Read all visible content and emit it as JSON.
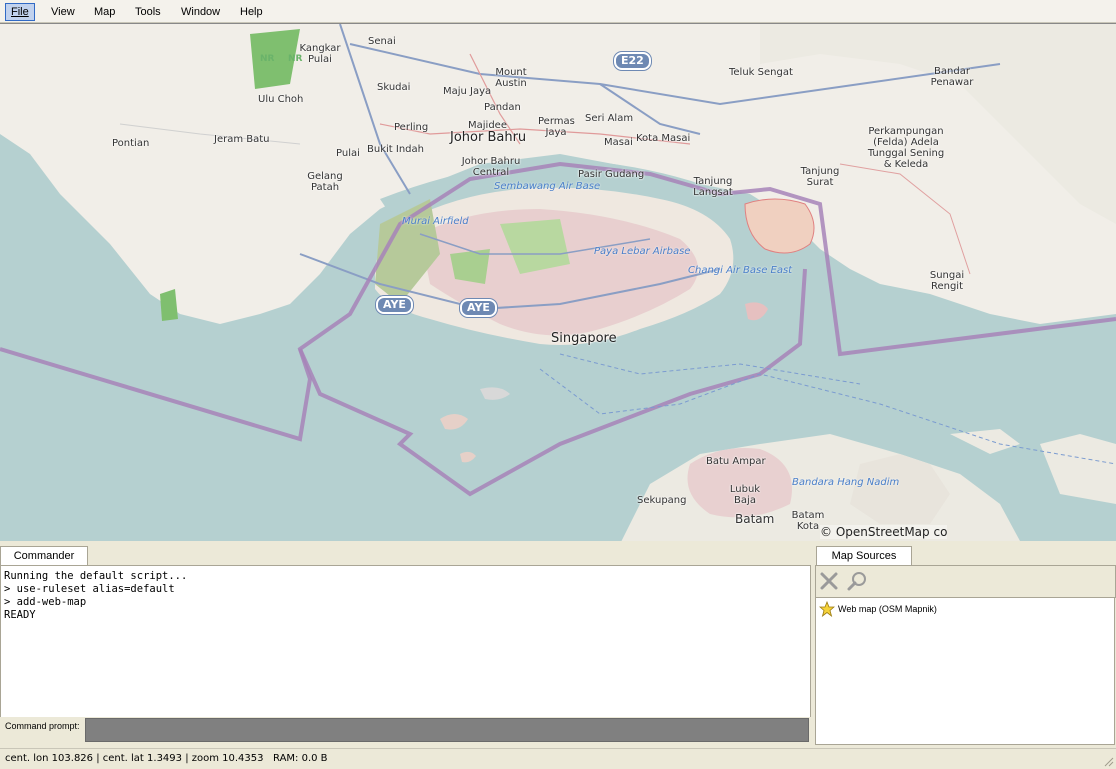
{
  "menu": {
    "file": "File",
    "view": "View",
    "map": "Map",
    "tools": "Tools",
    "window": "Window",
    "help": "Help"
  },
  "map": {
    "labels": {
      "senai": "Senai",
      "kangkar_pulai": "Kangkar Pulai",
      "ulu_choh": "Ulu Choh",
      "skudai": "Skudai",
      "majujaya": "Maju Jaya",
      "mount_austin": "Mount Austin",
      "pandan": "Pandan",
      "majidee": "Majidee",
      "permas_jaya": "Permas Jaya",
      "seri_alam": "Seri Alam",
      "masai": "Masai",
      "kota_masai": "Kota Masai",
      "teluk_sengat": "Teluk Sengat",
      "bandar_penawar": "Bandar Penawar",
      "pontian": "Pontian",
      "jeram_batu": "Jeram Batu",
      "perling": "Perling",
      "johor_bahru": "Johor Bahru",
      "pulai": "Pulai",
      "bukit_indah": "Bukit Indah",
      "johor_bahru_central": "Johor Bahru Central",
      "pasir_gudang": "Pasir Gudang",
      "perkampungan": "Perkampungan (Felda) Adela Tunggal Sening & Keleda",
      "gelang_patah": "Gelang Patah",
      "tanjung_langsat": "Tanjung Langsat",
      "tanjung_surat": "Tanjung Surat",
      "sembawang_air_base": "Sembawang Air Base",
      "murai_airfield": "Murai Airfield",
      "paya_lebar_airbase": "Paya Lebar Airbase",
      "changi_air_base_east": "Changi Air Base East",
      "sungai_rengit": "Sungai Rengit",
      "singapore": "Singapore",
      "batu_ampar": "Batu Ampar",
      "bandara_hang_nadim": "Bandara Hang Nadim",
      "lubuk_baja": "Lubuk Baja",
      "sekupang": "Sekupang",
      "batam": "Batam",
      "batam_kota": "Batam Kota"
    },
    "shields": {
      "e22": "E22",
      "aye1": "AYE",
      "aye2": "AYE"
    },
    "nr": "NR",
    "attribution": "© OpenStreetMap co"
  },
  "commander": {
    "tab_label": "Commander",
    "console_lines": "Running the default script...\n> use-ruleset alias=default\n> add-web-map\nREADY",
    "prompt_label": "Command prompt:"
  },
  "map_sources": {
    "tab_label": "Map Sources",
    "items": [
      {
        "label": "Web map (OSM Mapnik)"
      }
    ]
  },
  "status": {
    "text": "cent. lon 103.826 | cent. lat 1.3493 | zoom 10.4353   RAM: 0.0 B"
  }
}
